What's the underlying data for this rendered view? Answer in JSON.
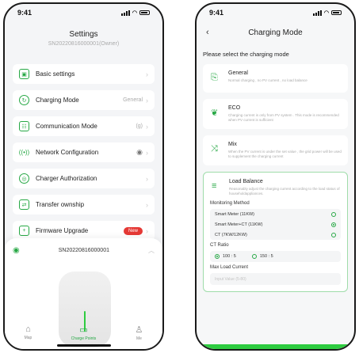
{
  "left": {
    "status_time": "9:41",
    "title": "Settings",
    "serial": "SN20220816000001(Owner)",
    "menu": [
      {
        "label": "Basic settings",
        "icon": "gear-icon",
        "value": ""
      },
      {
        "label": "Charging Mode",
        "icon": "charging-mode-icon",
        "value": "General"
      },
      {
        "label": "Communication Mode",
        "icon": "communication-icon",
        "value": "(g)"
      },
      {
        "label": "Network Configuration",
        "icon": "network-icon",
        "value": ""
      },
      {
        "label": "Charger Authorization",
        "icon": "authorization-icon",
        "value": ""
      },
      {
        "label": "Transfer ownship",
        "icon": "transfer-icon",
        "value": ""
      },
      {
        "label": "Firmware Upgrade",
        "icon": "firmware-icon",
        "value": "",
        "badge": "New"
      }
    ],
    "sheet_serial": "SN20220816000001",
    "tabs": [
      {
        "label": "Map",
        "icon": "map-icon",
        "active": false
      },
      {
        "label": "Charge Points",
        "icon": "charge-point-icon",
        "active": true
      },
      {
        "label": "Me",
        "icon": "user-icon",
        "active": false
      }
    ]
  },
  "right": {
    "status_time": "9:41",
    "title": "Charging Mode",
    "subtitle": "Please select the charging mode",
    "modes": [
      {
        "name": "General",
        "desc": "Normal charging , no PV current , no load balance",
        "icon": "plug-icon"
      },
      {
        "name": "ECO",
        "desc": "Charging current is only from PV system . This mode is recommended when PV current is sufficient",
        "icon": "leaf-icon"
      },
      {
        "name": "Mix",
        "desc": "When the PV current is under the set value , the grid power will be used to supplement the charging current",
        "icon": "mix-icon"
      }
    ],
    "load_balance": {
      "name": "Load Balance",
      "desc": "Reasonably adjust the charging current according to the load status of householdappliances.",
      "monitoring_label": "Monitoring Method",
      "methods": [
        {
          "label": "Smart Meter (11KW)",
          "selected": false
        },
        {
          "label": "Smart Meter+CT (11KW)",
          "selected": true
        },
        {
          "label": "CT (7KW/12KW)",
          "selected": false
        }
      ],
      "ct_label": "CT Ratio",
      "ct_options": [
        {
          "label": "100 : 5",
          "selected": true
        },
        {
          "label": "150 : 5",
          "selected": false
        }
      ],
      "max_label": "Max Load Current",
      "max_placeholder": "Input Value (5-80)"
    }
  }
}
